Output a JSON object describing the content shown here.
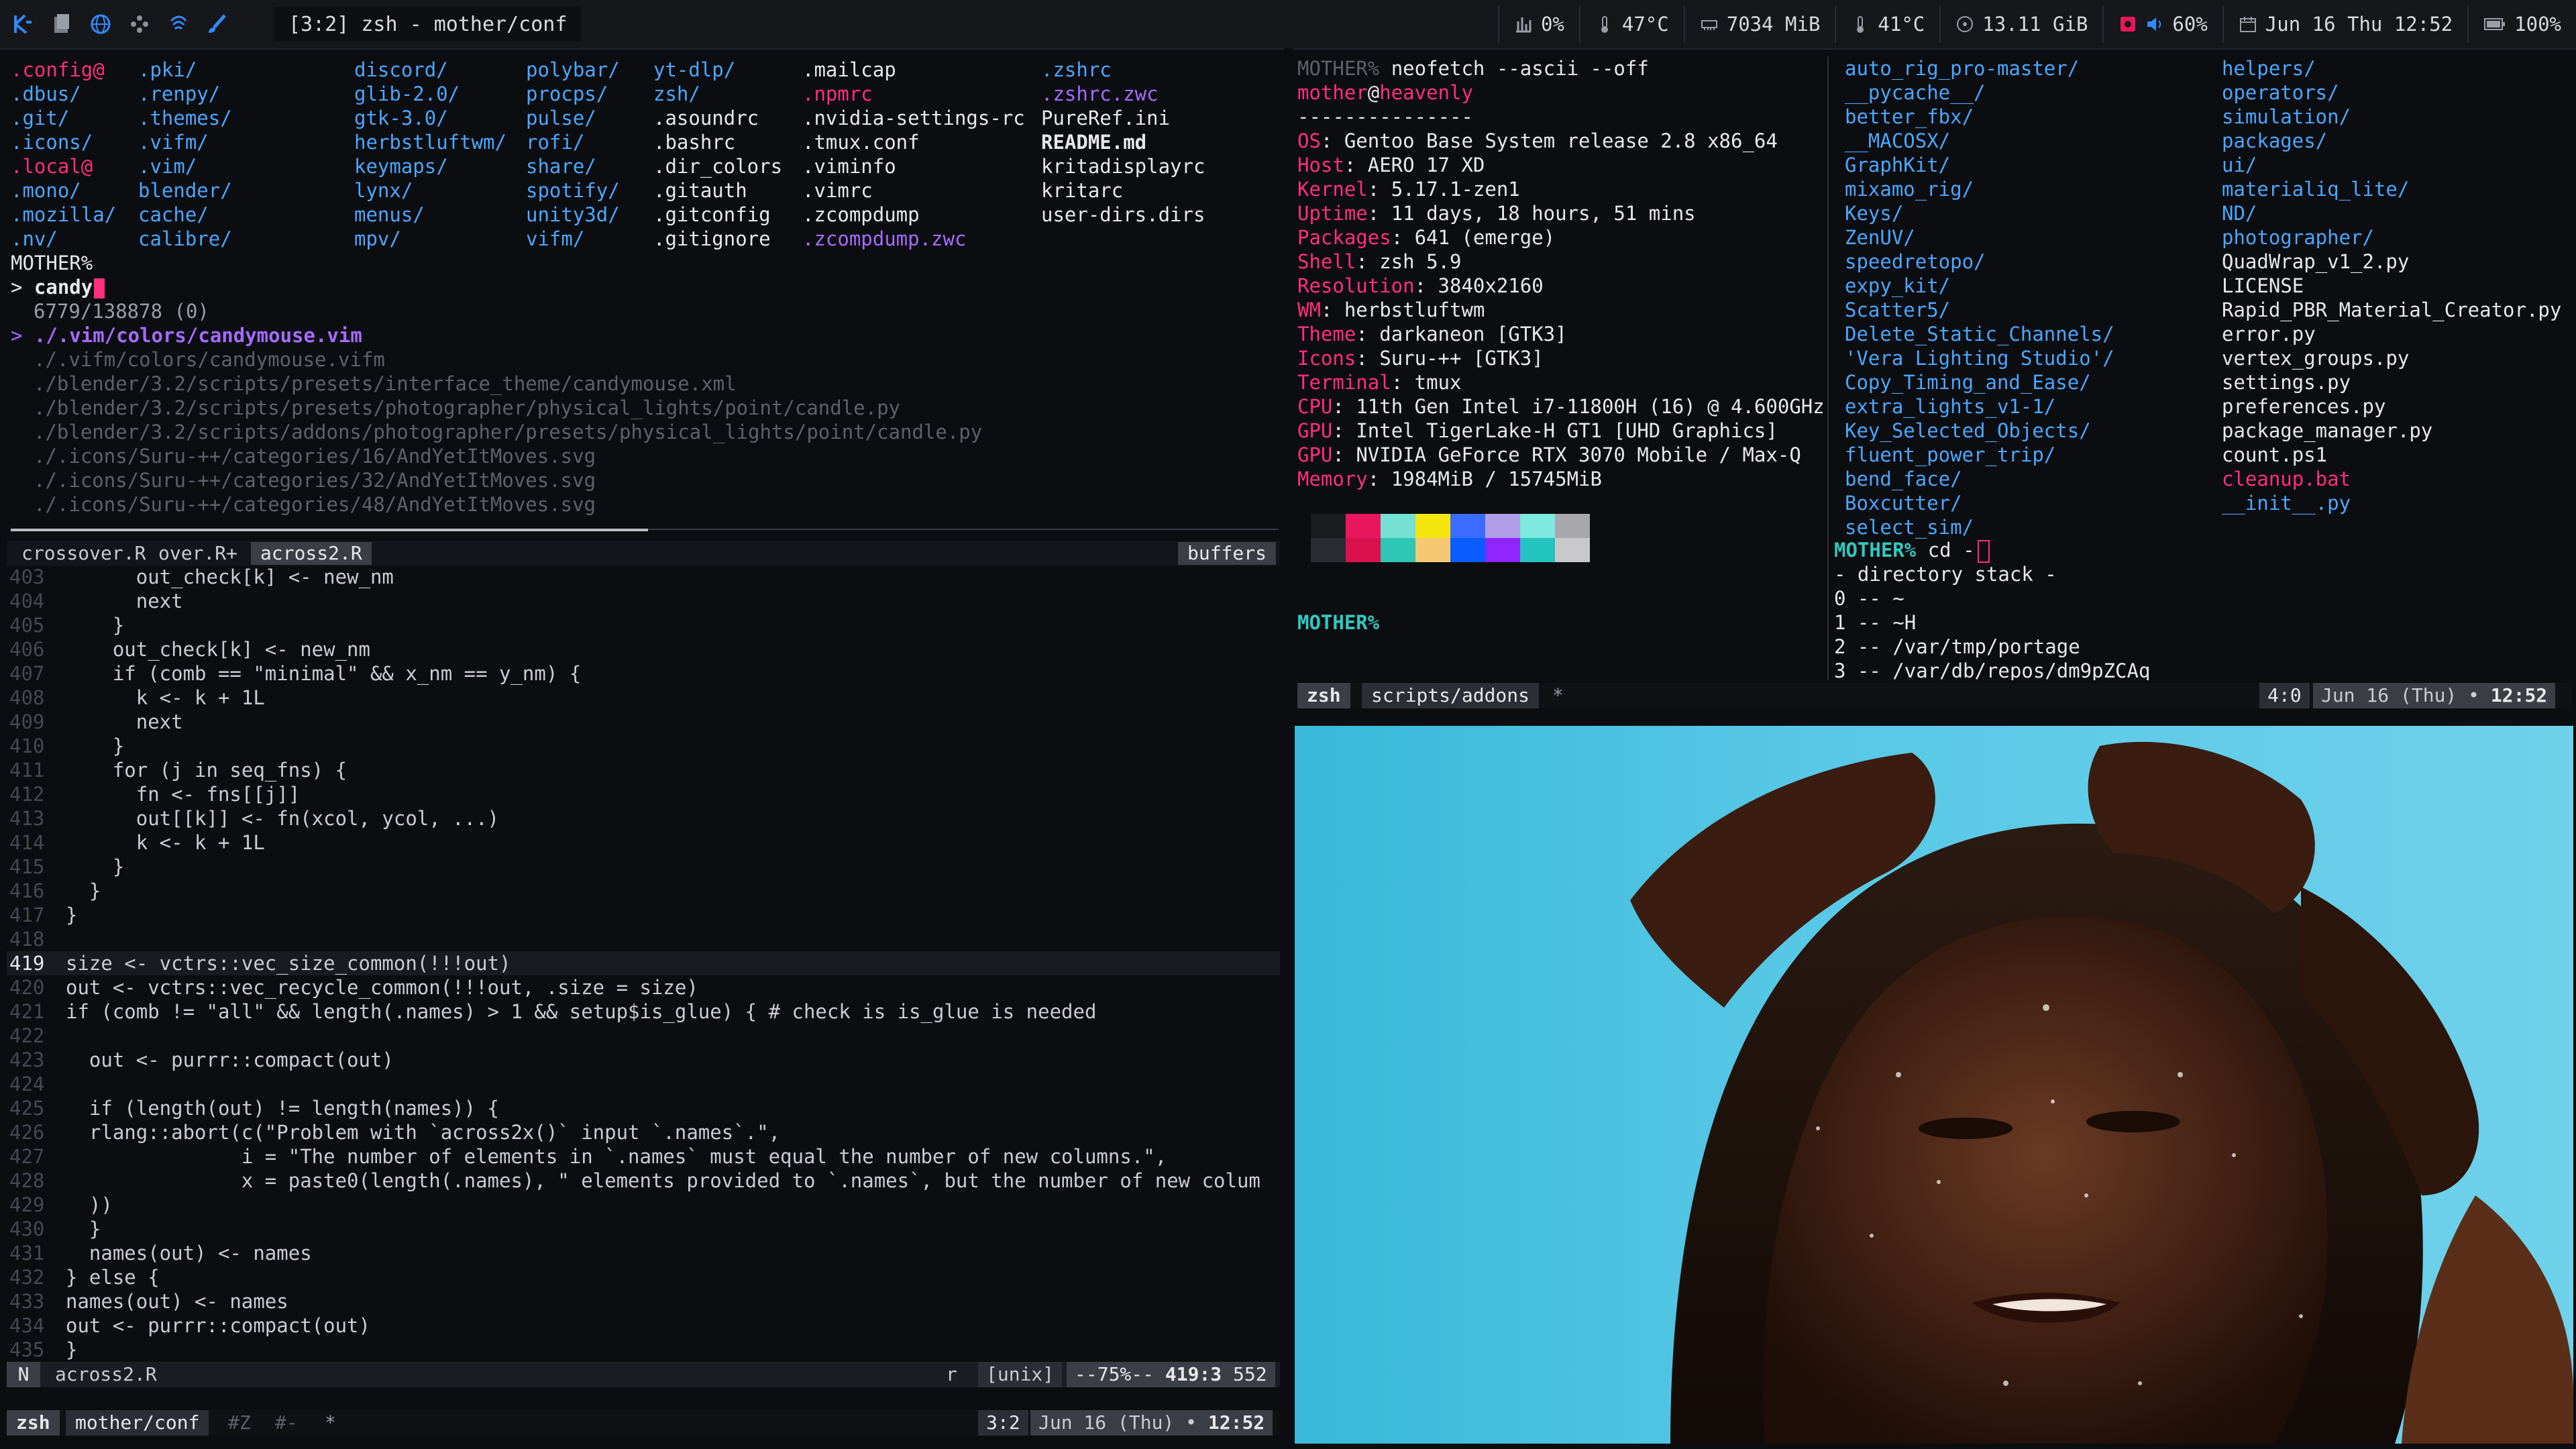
{
  "topbar": {
    "icons": [
      "kde-icon",
      "files-icon",
      "browser-icon",
      "network-icon",
      "vpn-icon",
      "brush-icon"
    ],
    "window_title": "[3:2] zsh - mother/conf",
    "stats": [
      {
        "icon": "cpu-chart-icon",
        "text": "0%"
      },
      {
        "icon": "thermometer-icon",
        "text": "47°C"
      },
      {
        "icon": "memory-icon",
        "text": "7034 MiB"
      },
      {
        "icon": "thermometer-icon",
        "text": "41°C"
      },
      {
        "icon": "disk-icon",
        "text": "13.11 GiB"
      },
      {
        "icon": "volume-icon",
        "text": "60%"
      },
      {
        "icon": "calendar-icon",
        "text": "Jun 16 Thu 12:52"
      },
      {
        "icon": "battery-icon",
        "text": "100%"
      }
    ]
  },
  "ls": {
    "col1": [
      ".config@",
      ".dbus/",
      ".git/",
      ".icons/",
      ".local@",
      ".mono/",
      ".mozilla/",
      ".nv/"
    ],
    "col2": [
      ".pki/",
      ".renpy/",
      ".themes/",
      ".vifm/",
      ".vim/",
      "blender/",
      "cache/",
      "calibre/"
    ],
    "col3": [
      "discord/",
      "glib-2.0/",
      "gtk-3.0/",
      "herbstluftwm/",
      "keymaps/",
      "lynx/",
      "menus/",
      "mpv/"
    ],
    "col4": [
      "polybar/",
      "procps/",
      "pulse/",
      "rofi/",
      "share/",
      "spotify/",
      "unity3d/",
      "vifm/"
    ],
    "col5": [
      "yt-dlp/",
      "zsh/",
      ".asoundrc",
      ".bashrc",
      ".dir_colors",
      ".gitauth",
      ".gitconfig",
      ".gitignore"
    ],
    "col6": [
      ".mailcap",
      ".npmrc",
      ".nvidia-settings-rc",
      ".tmux.conf",
      ".viminfo",
      ".vimrc",
      ".zcompdump",
      ".zcompdump.zwc"
    ],
    "col7": [
      ".zshrc",
      ".zshrc.zwc",
      "PureRef.ini",
      "README.md",
      "kritadisplayrc",
      "kritarc",
      "user-dirs.dirs"
    ]
  },
  "fzf": {
    "prompt_host": "MOTHER%",
    "query_prefix": "> ",
    "query": "candy",
    "count": "6779/138878 (0)",
    "selected": "./.vim/colors/candymouse.vim",
    "results": [
      "./.vifm/colors/candymouse.vifm",
      "./blender/3.2/scripts/presets/interface_theme/candymouse.xml",
      "./blender/3.2/scripts/presets/photographer/physical_lights/point/candle.py",
      "./blender/3.2/scripts/addons/photographer/presets/physical_lights/point/candle.py",
      "./.icons/Suru-++/categories/16/AndYetItMoves.svg",
      "./.icons/Suru-++/categories/32/AndYetItMoves.svg",
      "./.icons/Suru-++/categories/48/AndYetItMoves.svg"
    ]
  },
  "vim": {
    "tabs": [
      "crossover.R",
      "over.R+",
      "across2.R"
    ],
    "buffers_label": "buffers",
    "mode": "N",
    "filename": "across2.R",
    "ft": "r",
    "ff": "[unix]",
    "pos_pct": "--75%--",
    "pos_line": "419:3",
    "total": "552",
    "lines": [
      {
        "n": "403",
        "t": "      out_check[k] <- new_nm"
      },
      {
        "n": "404",
        "t": "      next"
      },
      {
        "n": "405",
        "t": "    }"
      },
      {
        "n": "406",
        "t": "    out_check[k] <- new_nm"
      },
      {
        "n": "407",
        "t": "    if (comb == \"minimal\" && x_nm == y_nm) {"
      },
      {
        "n": "408",
        "t": "      k <- k + 1L"
      },
      {
        "n": "409",
        "t": "      next"
      },
      {
        "n": "410",
        "t": "    }"
      },
      {
        "n": "411",
        "t": "    for (j in seq_fns) {"
      },
      {
        "n": "412",
        "t": "      fn <- fns[[j]]"
      },
      {
        "n": "413",
        "t": "      out[[k]] <- fn(xcol, ycol, ...)"
      },
      {
        "n": "414",
        "t": "      k <- k + 1L"
      },
      {
        "n": "415",
        "t": "    }"
      },
      {
        "n": "416",
        "t": "  }"
      },
      {
        "n": "417",
        "t": "}"
      },
      {
        "n": "418",
        "t": ""
      },
      {
        "n": "419",
        "t": "size <- vctrs::vec_size_common(!!!out)"
      },
      {
        "n": "420",
        "t": "out <- vctrs::vec_recycle_common(!!!out, .size = size)"
      },
      {
        "n": "421",
        "t": "if (comb != \"all\" && length(.names) > 1 && setup$is_glue) { # check is is_glue is needed"
      },
      {
        "n": "422",
        "t": ""
      },
      {
        "n": "423",
        "t": "  out <- purrr::compact(out)"
      },
      {
        "n": "424",
        "t": ""
      },
      {
        "n": "425",
        "t": "  if (length(out) != length(names)) {"
      },
      {
        "n": "426",
        "t": "  rlang::abort(c(\"Problem with `across2x()` input `.names`.\","
      },
      {
        "n": "427",
        "t": "               i = \"The number of elements in `.names` must equal the number of new columns.\","
      },
      {
        "n": "428",
        "t": "               x = paste0(length(.names), \" elements provided to `.names`, but the number of new colum"
      },
      {
        "n": "429",
        "t": "  ))"
      },
      {
        "n": "430",
        "t": "  }"
      },
      {
        "n": "431",
        "t": "  names(out) <- names"
      },
      {
        "n": "432",
        "t": "} else {"
      },
      {
        "n": "433",
        "t": "names(out) <- names"
      },
      {
        "n": "434",
        "t": "out <- purrr::compact(out)"
      },
      {
        "n": "435",
        "t": "}"
      }
    ]
  },
  "tmux_left": {
    "session": "zsh",
    "window": "mother/conf",
    "flags1": "#Z",
    "flags2": "#-",
    "star": "*",
    "pane_id": "3:2",
    "date": "Jun 16 (Thu)",
    "bullet": "•",
    "time": "12:52"
  },
  "neofetch": {
    "cmd_host": "MOTHER%",
    "cmd": "neofetch --ascii --off",
    "user": "mother",
    "at": "@",
    "host": "heavenly",
    "rule": "---------------",
    "rows": [
      {
        "k": "OS",
        "v": "Gentoo Base System release 2.8 x86_64"
      },
      {
        "k": "Host",
        "v": "AERO 17 XD"
      },
      {
        "k": "Kernel",
        "v": "5.17.1-zen1"
      },
      {
        "k": "Uptime",
        "v": "11 days, 18 hours, 51 mins"
      },
      {
        "k": "Packages",
        "v": "641 (emerge)"
      },
      {
        "k": "Shell",
        "v": "zsh 5.9"
      },
      {
        "k": "Resolution",
        "v": "3840x2160"
      },
      {
        "k": "WM",
        "v": "herbstluftwm"
      },
      {
        "k": "Theme",
        "v": "darkaneon [GTK3]"
      },
      {
        "k": "Icons",
        "v": "Suru-++ [GTK3]"
      },
      {
        "k": "Terminal",
        "v": "tmux"
      },
      {
        "k": "CPU",
        "v": "11th Gen Intel i7-11800H (16) @ 4.600GHz"
      },
      {
        "k": "GPU",
        "v": "Intel TigerLake-H GT1 [UHD Graphics]"
      },
      {
        "k": "GPU",
        "v": "NVIDIA GeForce RTX 3070 Mobile / Max-Q"
      },
      {
        "k": "Memory",
        "v": "1984MiB / 15745MiB"
      }
    ],
    "palette_top": [
      "#1b1c20",
      "#e8175d",
      "#76e0d4",
      "#f5e50f",
      "#3b6cff",
      "#b09ee8",
      "#7de9df",
      "#a9a9ad"
    ],
    "palette_bottom": [
      "#2a2c31",
      "#d9124f",
      "#2ec6b4",
      "#f7c873",
      "#0a5cff",
      "#8f25ff",
      "#23c3c0",
      "#c9c9cc"
    ],
    "prompt_after": "MOTHER%"
  },
  "dirlist": {
    "col1": [
      {
        "t": "auto_rig_pro-master/",
        "c": "blue"
      },
      {
        "t": "__pycache__/",
        "c": "blue"
      },
      {
        "t": "better_fbx/",
        "c": "blue"
      },
      {
        "t": "__MACOSX/",
        "c": "blue"
      },
      {
        "t": "GraphKit/",
        "c": "blue"
      },
      {
        "t": "mixamo_rig/",
        "c": "blue"
      },
      {
        "t": "Keys/",
        "c": "blue"
      },
      {
        "t": "ZenUV/",
        "c": "blue"
      },
      {
        "t": "speedretopo/",
        "c": "blue"
      },
      {
        "t": "expy_kit/",
        "c": "blue"
      },
      {
        "t": "Scatter5/",
        "c": "blue"
      },
      {
        "t": "Delete_Static_Channels/",
        "c": "blue"
      },
      {
        "t": "'Vera Lighting Studio'/",
        "c": "blue"
      },
      {
        "t": "Copy_Timing_and_Ease/",
        "c": "blue"
      },
      {
        "t": "extra_lights_v1-1/",
        "c": "blue"
      },
      {
        "t": "Key_Selected_Objects/",
        "c": "blue"
      },
      {
        "t": "fluent_power_trip/",
        "c": "blue"
      },
      {
        "t": "bend_face/",
        "c": "blue"
      },
      {
        "t": "Boxcutter/",
        "c": "blue"
      },
      {
        "t": "select_sim/",
        "c": "blue"
      }
    ],
    "col2": [
      {
        "t": "helpers/",
        "c": "blue"
      },
      {
        "t": "operators/",
        "c": "blue"
      },
      {
        "t": "simulation/",
        "c": "blue"
      },
      {
        "t": "packages/",
        "c": "blue"
      },
      {
        "t": "ui/",
        "c": "blue"
      },
      {
        "t": "materialiq_lite/",
        "c": "blue"
      },
      {
        "t": "ND/",
        "c": "blue"
      },
      {
        "t": "photographer/",
        "c": "blue"
      },
      {
        "t": "QuadWrap_v1_2.py",
        "c": "white"
      },
      {
        "t": "LICENSE",
        "c": "white"
      },
      {
        "t": "Rapid_PBR_Material_Creator.py",
        "c": "white"
      },
      {
        "t": "error.py",
        "c": "white"
      },
      {
        "t": "vertex_groups.py",
        "c": "white"
      },
      {
        "t": "settings.py",
        "c": "white"
      },
      {
        "t": "preferences.py",
        "c": "white"
      },
      {
        "t": "package_manager.py",
        "c": "white"
      },
      {
        "t": "count.ps1",
        "c": "white"
      },
      {
        "t": "cleanup.bat",
        "c": "pink"
      },
      {
        "t": "__init__.py",
        "c": "blue"
      }
    ],
    "cd_prompt": "MOTHER%",
    "cd_cmd": "cd -",
    "stack_title": "- directory stack -",
    "stack": [
      "0 -- ~",
      "1 -- ~H",
      "2 -- /var/tmp/portage",
      "3 -- /var/db/repos/dm9pZCAq"
    ]
  },
  "tmux_right": {
    "session": "zsh",
    "window": "scripts/addons",
    "star": "*",
    "pane_id": "4:0",
    "date": "Jun 16 (Thu)",
    "bullet": "•",
    "time": "12:52"
  },
  "image": {
    "alt": "photo-woman-water"
  }
}
